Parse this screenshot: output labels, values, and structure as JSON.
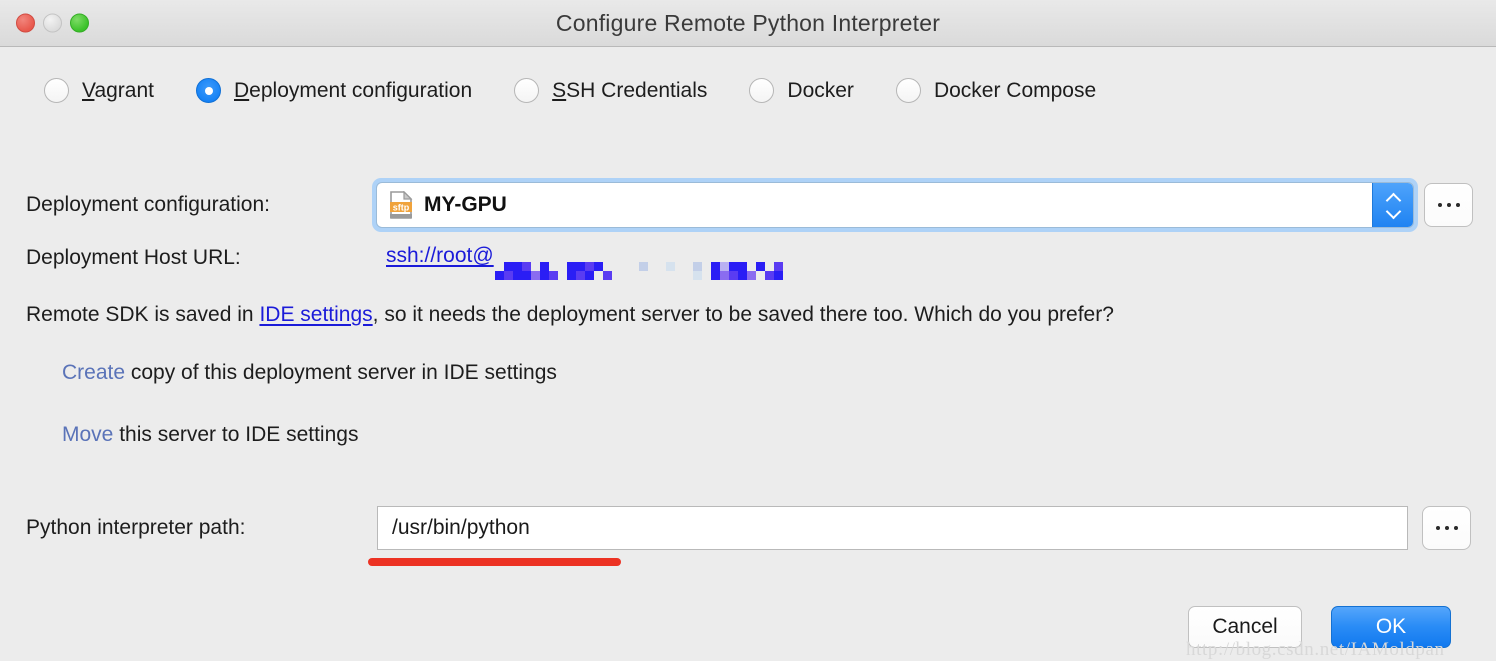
{
  "window": {
    "title": "Configure Remote Python Interpreter",
    "traffic_lights": [
      "close-button",
      "minimize-button",
      "maximize-button"
    ]
  },
  "interpreter_type": {
    "selected": "Deployment configuration",
    "options": [
      {
        "label": "Vagrant",
        "mnemonic": "V",
        "rest": "agrant",
        "checked": false
      },
      {
        "label": "Deployment configuration",
        "mnemonic": "D",
        "rest": "eployment configuration",
        "checked": true
      },
      {
        "label": "SSH Credentials",
        "mnemonic": "S",
        "rest": "SH Credentials",
        "checked": false
      },
      {
        "label": "Docker",
        "mnemonic": "",
        "rest": "Docker",
        "checked": false
      },
      {
        "label": "Docker Compose",
        "mnemonic": "",
        "rest": "Docker Compose",
        "checked": false
      }
    ]
  },
  "deployment": {
    "label": "Deployment configuration:",
    "value": "MY-GPU",
    "icon": "sftp-file-icon",
    "icon_badge": "sftp",
    "browse_label": "...",
    "stepper": "up-down-chevrons"
  },
  "host": {
    "label": "Deployment Host URL:",
    "url_visible": "ssh://root@",
    "url_redacted": true
  },
  "notice": {
    "prefix": "Remote SDK is saved in ",
    "link": "IDE settings",
    "suffix": ", so it needs the deployment server to be saved there too. Which do you prefer?"
  },
  "choices": [
    {
      "action": "Create",
      "text": " copy of this deployment server in IDE settings"
    },
    {
      "action": "Move",
      "text": " this server to IDE settings"
    }
  ],
  "interpreter_path": {
    "label": "Python interpreter path:",
    "value": "/usr/bin/python",
    "placeholder": "",
    "browse_label": "..."
  },
  "footer": {
    "cancel_label": "Cancel",
    "ok_label": "OK"
  },
  "watermark": "http://blog.csdn.net/IAMoldpan",
  "colors": {
    "accent_blue": "#1f83f2",
    "link_blue": "#1b1bd9",
    "link_slate": "#5a73b8",
    "annotation_red": "#ec3223",
    "window_bg": "#ececec"
  }
}
